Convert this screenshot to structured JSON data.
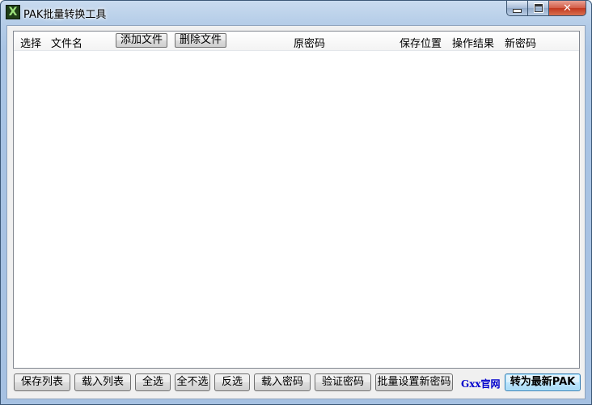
{
  "window": {
    "title": "PAK批量转换工具",
    "icon_glyph": "X",
    "close_glyph": "✕"
  },
  "list": {
    "columns": {
      "select": "选择",
      "filename": "文件名",
      "original_password": "原密码",
      "save_location": "保存位置",
      "result": "操作结果",
      "new_password": "新密码"
    },
    "add_file_label": "添加文件",
    "delete_file_label": "删除文件",
    "rows": []
  },
  "toolbar": {
    "save_list": "保存列表",
    "load_list": "载入列表",
    "select_all": "全选",
    "select_none": "全不选",
    "invert": "反选",
    "load_password": "载入密码",
    "verify_password": "验证密码",
    "batch_set_password": "批量设置新密码",
    "official_site": "Gxx官网",
    "convert": "转为最新PAK"
  },
  "colors": {
    "link": "#0000cc",
    "close_button": "#c2381f",
    "titlebar": "#b5cde8"
  }
}
